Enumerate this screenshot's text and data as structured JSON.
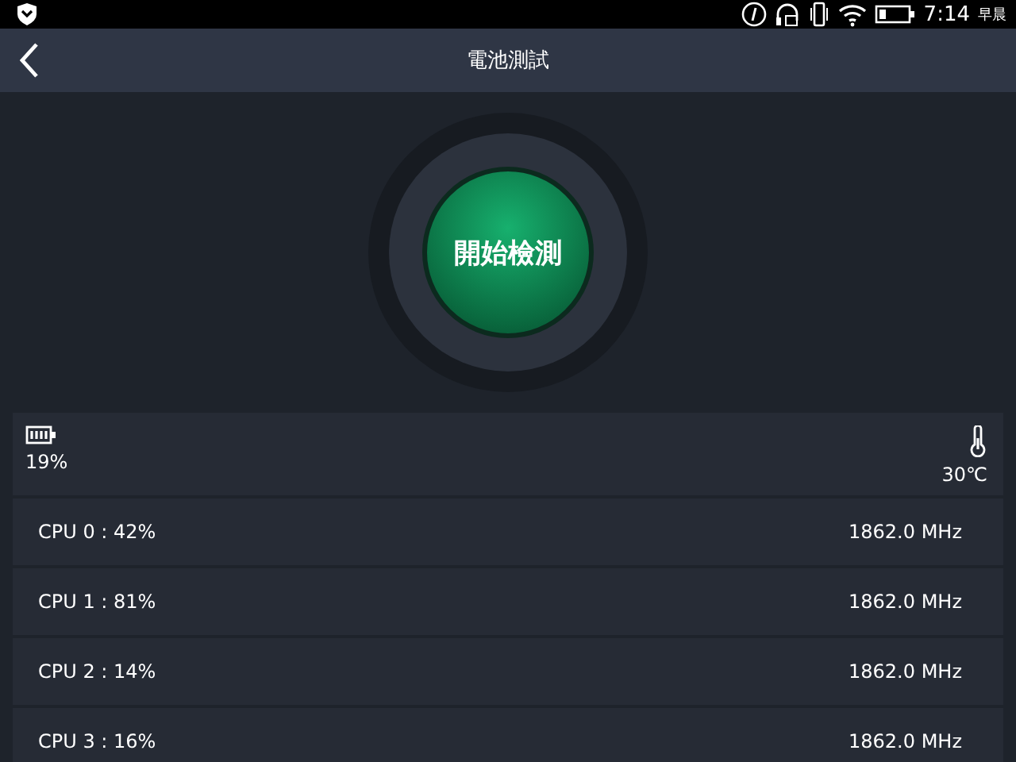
{
  "status_bar": {
    "time": "7:14",
    "period": "早晨"
  },
  "header": {
    "title": "電池測試"
  },
  "start_button": {
    "label": "開始檢測"
  },
  "summary": {
    "battery": "19%",
    "temperature": "30℃"
  },
  "cpus": [
    {
      "label": "CPU  0 : 42%",
      "frequency": "1862.0 MHz"
    },
    {
      "label": "CPU  1 : 81%",
      "frequency": "1862.0 MHz"
    },
    {
      "label": "CPU  2 : 14%",
      "frequency": "1862.0 MHz"
    },
    {
      "label": "CPU  3 : 16%",
      "frequency": "1862.0 MHz"
    }
  ]
}
